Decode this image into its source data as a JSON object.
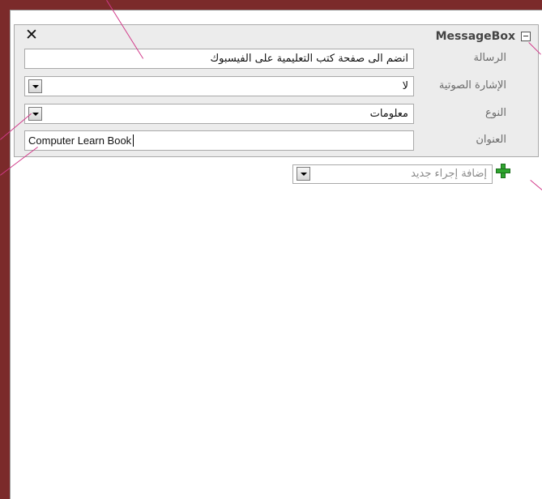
{
  "macro": {
    "title": "MessageBox",
    "close_symbol": "✕",
    "rows": {
      "message": {
        "label": "الرسالة",
        "value": "انضم الى صفحة كتب التعليمية على الفيسبوك"
      },
      "beep": {
        "label": "الإشارة الصوتية",
        "value": "لا"
      },
      "type": {
        "label": "النوع",
        "value": "معلومات"
      },
      "title_field": {
        "label": "العنوان",
        "value": "Computer Learn Book"
      }
    }
  },
  "add_action": {
    "placeholder": "إضافة إجراء جديد"
  },
  "icons": {
    "close": "close-icon",
    "collapse": "collapse-icon",
    "dropdown": "chevron-down-icon",
    "add": "plus-icon"
  },
  "colors": {
    "background": "#7b2a2a",
    "callout": "#d23a8a",
    "add_icon": "#2fa52f"
  }
}
